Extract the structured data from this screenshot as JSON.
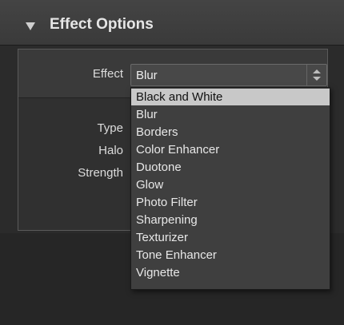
{
  "header": {
    "title": "Effect Options"
  },
  "labels": {
    "effect": "Effect",
    "type": "Type",
    "halo": "Halo",
    "strength": "Strength"
  },
  "select": {
    "value": "Blur"
  },
  "dropdown": {
    "options": [
      "Black and White",
      "Blur",
      "Borders",
      "Color Enhancer",
      "Duotone",
      "Glow",
      "Photo Filter",
      "Sharpening",
      "Texturizer",
      "Tone Enhancer",
      "Vignette"
    ],
    "highlighted": "Black and White"
  },
  "colors": {
    "highlight": "#c8c8c8",
    "panel": "#353535",
    "text": "#e8e8e8"
  }
}
